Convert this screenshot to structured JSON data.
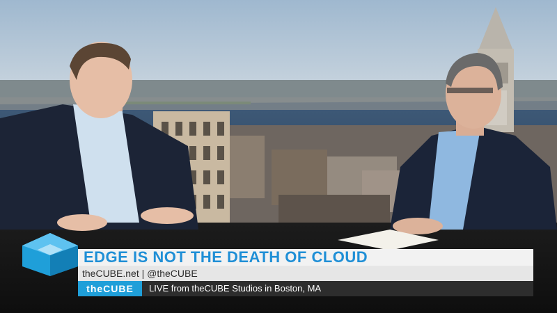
{
  "lower_third": {
    "headline": "EDGE IS NOT THE DEATH OF CLOUD",
    "subline": "theCUBE.net | @theCUBE",
    "brand": "theCUBE",
    "live": "LIVE from theCUBE Studios in Boston, MA"
  },
  "colors": {
    "brand_blue": "#1f9fd9",
    "headline_blue": "#1f8fd6",
    "bar_dark": "#2d2d2d"
  }
}
